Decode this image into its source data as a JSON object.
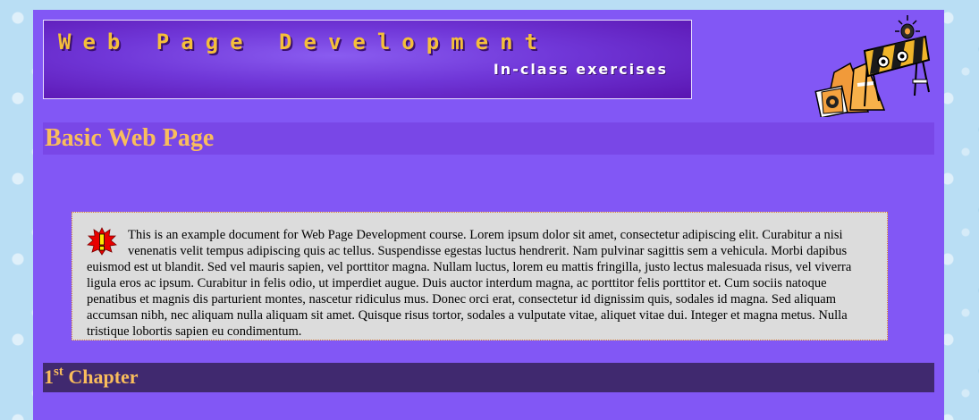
{
  "banner": {
    "title": "Web Page Development",
    "subtitle": "In-class exercises"
  },
  "page": {
    "title": "Basic Web Page"
  },
  "notice": {
    "icon": "exclamation-icon",
    "text": "This is an example document for Web Page Development course. Lorem ipsum dolor sit amet, consectetur adipiscing elit. Curabitur a nisi venenatis velit tempus adipiscing quis ac tellus. Suspendisse egestas luctus hendrerit. Nam pulvinar sagittis sem a vehicula. Morbi dapibus euismod est ut blandit. Sed vel mauris sapien, vel porttitor magna. Nullam luctus, lorem eu mattis fringilla, justo lectus malesuada risus, vel viverra ligula eros ac ipsum. Curabitur in felis odio, ut imperdiet augue. Duis auctor interdum magna, ac porttitor felis porttitor et. Cum sociis natoque penatibus et magnis dis parturient montes, nascetur ridiculus mus. Donec orci erat, consectetur id dignissim quis, sodales id magna. Sed aliquam accumsan nibh, nec aliquam nulla aliquam sit amet. Quisque risus tortor, sodales a vulputate vitae, aliquet vitae dui. Integer et magna metus. Nulla tristique lobortis sapien eu condimentum."
  },
  "chapter": {
    "number": "1",
    "ordinal_suffix": "st",
    "label": "Chapter"
  },
  "colors": {
    "page_background": "#8257f5",
    "heading_text": "#f9bd5c",
    "chapter_bar": "#40296f",
    "notice_background": "#dcdcdc"
  },
  "decorations": {
    "construction": "construction-barrier-icon"
  }
}
